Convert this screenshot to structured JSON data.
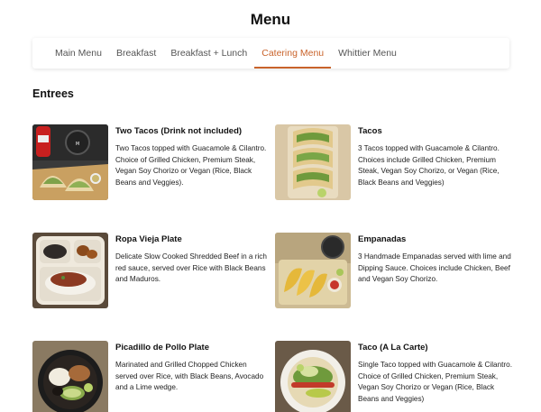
{
  "page": {
    "title": "Menu"
  },
  "tabs": [
    {
      "label": "Main Menu",
      "active": false
    },
    {
      "label": "Breakfast",
      "active": false
    },
    {
      "label": "Breakfast + Lunch",
      "active": false
    },
    {
      "label": "Catering Menu",
      "active": true
    },
    {
      "label": "Whittier Menu",
      "active": false
    }
  ],
  "colors": {
    "accent": "#c9632b"
  },
  "section": {
    "title": "Entrees"
  },
  "items": [
    {
      "name": "Two Tacos (Drink not included)",
      "description": "Two Tacos topped with Guacamole & Cilantro. Choice of Grilled Chicken, Premium Steak, Vegan Soy Chorizo or Vegan (Rice, Black Beans and Veggies)."
    },
    {
      "name": "Tacos",
      "description": "3 Tacos topped with Guacamole & Cilantro. Choices include Grilled Chicken, Premium Steak, Vegan Soy Chorizo, or Vegan (Rice, Black Beans and Veggies)"
    },
    {
      "name": "Ropa Vieja Plate",
      "description": "Delicate Slow Cooked Shredded Beef in a rich red sauce, served over Rice with Black Beans and Maduros."
    },
    {
      "name": "Empanadas",
      "description": "3 Handmade Empanadas served with lime and Dipping Sauce. Choices include Chicken, Beef and Vegan Soy Chorizo."
    },
    {
      "name": "Picadillo de Pollo Plate",
      "description": "Marinated and Grilled Chopped Chicken served over Rice, with Black Beans, Avocado and a Lime wedge."
    },
    {
      "name": "Taco (A La Carte)",
      "description": "Single Taco topped with Guacamole & Cilantro. Choice of Grilled Chicken, Premium Steak, Vegan Soy Chorizo or Vegan (Rice, Black Beans and Veggies)"
    }
  ]
}
